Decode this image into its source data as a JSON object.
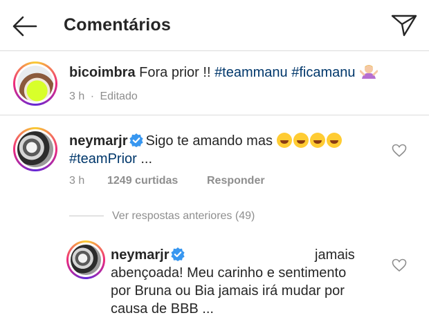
{
  "header": {
    "title": "Comentários",
    "back_icon": "arrow-left-icon",
    "send_icon": "paper-plane-icon"
  },
  "caption": {
    "username": "bicoimbra",
    "text": " Fora prior !! ",
    "hashtag1": "#teammanu",
    "hashtag2": " #ficamanu",
    "time": "3 h",
    "edited": "Editado"
  },
  "comment": {
    "username": "neymarjr",
    "text": "Sigo te amando mas",
    "hashtag": "#teamPrior",
    "ellipsis": " ...",
    "time": "3 h",
    "likes": "1249 curtidas",
    "reply": "Responder"
  },
  "replies_toggle": "Ver respostas anteriores (49)",
  "reply": {
    "username": "neymarjr",
    "line1_end": "jamais",
    "line2": "abençoada! Meu carinho e sentimento",
    "line3": "por Bruna ou Bia jamais irá mudar por",
    "line4": "causa de BBB ..."
  },
  "colors": {
    "verified": "#3897f0",
    "hashtag": "#00376b",
    "muted": "#8e8e8e"
  }
}
